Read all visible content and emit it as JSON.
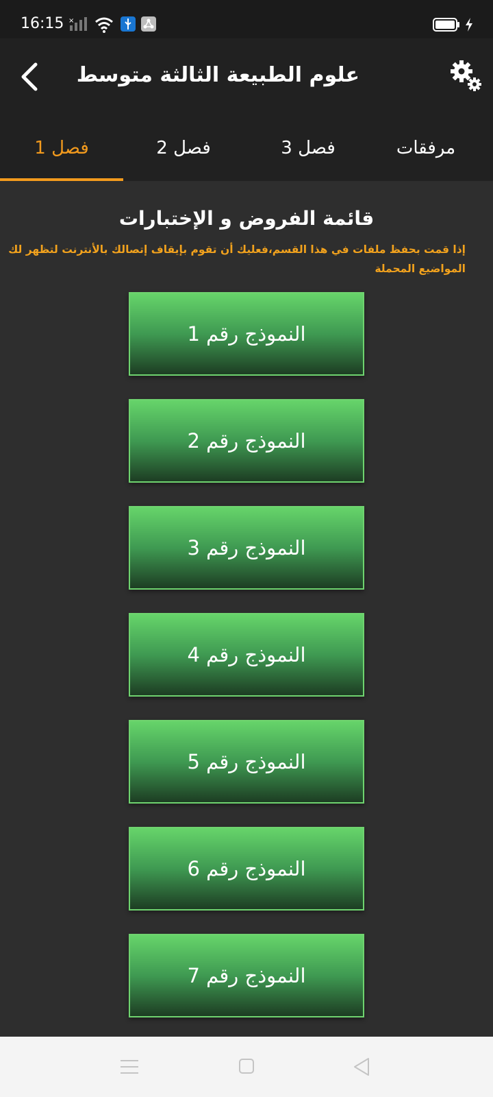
{
  "status_bar": {
    "time": "16:15",
    "icons": [
      "signal-icon",
      "wifi-icon",
      "usb-icon",
      "share-icon",
      "battery-icon",
      "charging-icon"
    ]
  },
  "app_bar": {
    "title": "علوم الطبيعة الثالثة متوسط",
    "back_icon": "chevron-left-icon",
    "settings_icon": "gears-icon"
  },
  "tabs": [
    {
      "label": "فصل 1",
      "active": true
    },
    {
      "label": "فصل 2",
      "active": false
    },
    {
      "label": "فصل 3",
      "active": false
    },
    {
      "label": "مرفقات",
      "active": false
    }
  ],
  "content": {
    "section_title": "قائمة الفروض و الإختبارات",
    "notice": "إذا قمت بحفظ ملفات في هذا القسم،فعليك أن تقوم بإيقاف إتصالك بالأنترنت لتظهر لك المواضيع المحملة",
    "models": [
      {
        "label": "النموذج رقم 1"
      },
      {
        "label": "النموذج رقم 2"
      },
      {
        "label": "النموذج رقم 3"
      },
      {
        "label": "النموذج رقم 4"
      },
      {
        "label": "النموذج رقم 5"
      },
      {
        "label": "النموذج رقم 6"
      },
      {
        "label": "النموذج رقم 7"
      }
    ]
  },
  "colors": {
    "accent": "#f29a1d",
    "button_green": "#66d46a",
    "background": "#2e2e2e",
    "bar": "#212121"
  },
  "nav_bar": {
    "icons": [
      "menu-icon",
      "home-icon",
      "back-triangle-icon"
    ]
  }
}
